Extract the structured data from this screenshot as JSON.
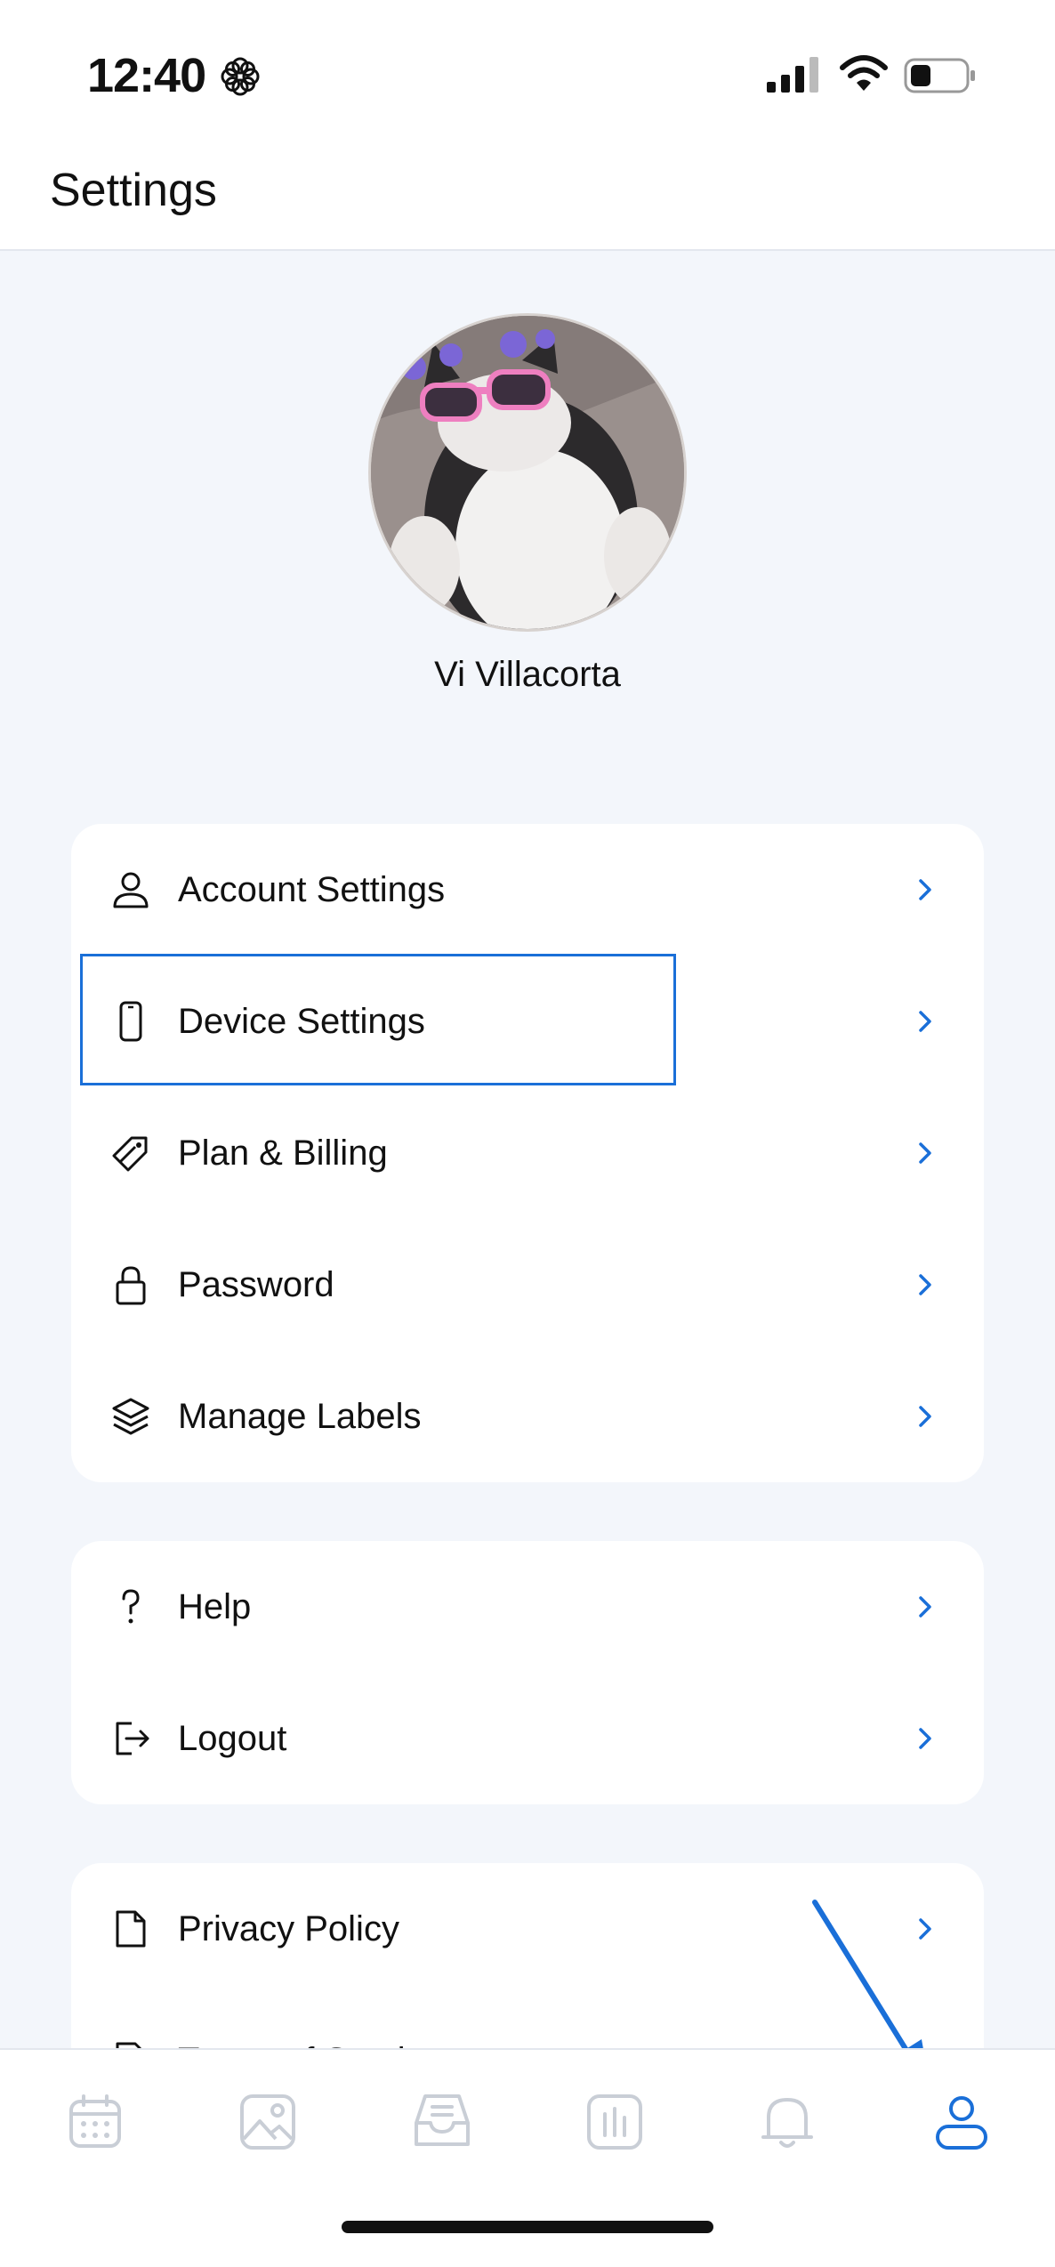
{
  "status_bar": {
    "time": "12:40"
  },
  "header": {
    "title": "Settings"
  },
  "profile": {
    "name": "Vi Villacorta"
  },
  "card1": {
    "items": [
      {
        "label": "Account Settings",
        "icon": "person-icon"
      },
      {
        "label": "Device Settings",
        "icon": "phone-icon"
      },
      {
        "label": "Plan & Billing",
        "icon": "tag-icon"
      },
      {
        "label": "Password",
        "icon": "lock-icon"
      },
      {
        "label": "Manage Labels",
        "icon": "layers-icon"
      }
    ]
  },
  "card2": {
    "items": [
      {
        "label": "Help",
        "icon": "question-icon"
      },
      {
        "label": "Logout",
        "icon": "logout-icon"
      }
    ]
  },
  "card3": {
    "items": [
      {
        "label": "Privacy Policy",
        "icon": "document-icon"
      },
      {
        "label": "Terms of Service",
        "icon": "document-icon"
      }
    ]
  },
  "tabbar": {
    "tabs": [
      {
        "icon": "calendar-icon",
        "active": false
      },
      {
        "icon": "image-icon",
        "active": false
      },
      {
        "icon": "inbox-icon",
        "active": false
      },
      {
        "icon": "chart-icon",
        "active": false
      },
      {
        "icon": "bell-icon",
        "active": false
      },
      {
        "icon": "person-icon",
        "active": true
      }
    ]
  },
  "colors": {
    "accent": "#1a6fd8",
    "inactive": "#c9ced6",
    "chevron": "#1a6fd8"
  }
}
